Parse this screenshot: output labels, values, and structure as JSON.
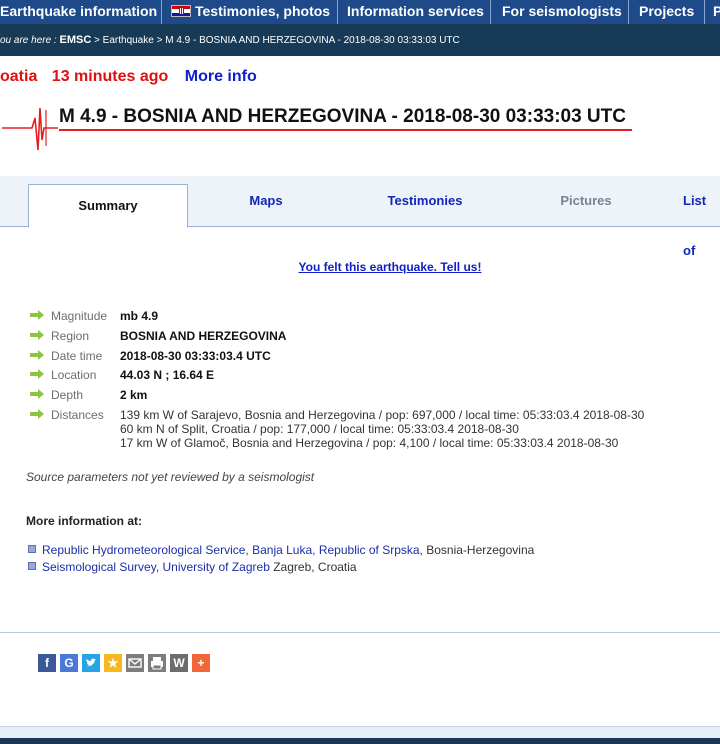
{
  "nav": {
    "items": [
      {
        "label": "Earthquake information"
      },
      {
        "label": "Testimonies, photos"
      },
      {
        "label": "Information services"
      },
      {
        "label": "For seismologists"
      },
      {
        "label": "Projects"
      },
      {
        "label": "P"
      }
    ]
  },
  "breadcrumb": {
    "prefix": "ou are here : ",
    "root": "EMSC",
    "rest": " > Earthquake > M 4.9 - BOSNIA AND HERZEGOVINA - 2018-08-30 03:33:03 UTC"
  },
  "headline": {
    "region_fragment": "oatia",
    "ago": "13 minutes ago",
    "more_info": "More info"
  },
  "title": "M 4.9 - BOSNIA AND HERZEGOVINA - 2018-08-30 03:33:03 UTC",
  "tabs": [
    {
      "label": "Summary",
      "state": "active"
    },
    {
      "label": "Maps",
      "state": "normal"
    },
    {
      "label": "Testimonies",
      "state": "normal"
    },
    {
      "label": "Pictures",
      "state": "disabled"
    },
    {
      "label": "List of",
      "state": "normal"
    }
  ],
  "felt_link": "You felt this earthquake. Tell us!",
  "details": {
    "magnitude": {
      "label": "Magnitude",
      "value": "mb 4.9"
    },
    "region": {
      "label": "Region",
      "value": "BOSNIA AND HERZEGOVINA"
    },
    "datetime": {
      "label": "Date time",
      "value": "2018-08-30 03:33:03.4 UTC"
    },
    "location": {
      "label": "Location",
      "value": "44.03 N ; 16.64 E"
    },
    "depth": {
      "label": "Depth",
      "value": "2 km"
    },
    "distances": {
      "label": "Distances",
      "lines": [
        "139 km W of Sarajevo, Bosnia and Herzegovina / pop: 697,000 / local time: 05:33:03.4 2018-08-30",
        "60 km N of Split, Croatia / pop: 177,000 / local time: 05:33:03.4 2018-08-30",
        "17 km W of Glamoč, Bosnia and Herzegovina / pop: 4,100 / local time: 05:33:03.4 2018-08-30"
      ]
    }
  },
  "source_note": "Source parameters not yet reviewed by a seismologist",
  "more_info_heading": "More information at:",
  "links": [
    {
      "a": "Republic Hydrometeorological Service, Banja Luka,",
      "b": "Republic of Srpska,",
      "c": "Bosnia-Herzegovina"
    },
    {
      "a": "Seismological Survey, University of Zagreb",
      "b": "",
      "c": "Zagreb, Croatia"
    }
  ],
  "share_icons": [
    "facebook-icon",
    "google-icon",
    "twitter-icon",
    "favorite-icon",
    "email-icon",
    "print-icon",
    "wordpress-icon",
    "more-icon"
  ],
  "colors": {
    "nav_bg": "#1e4a8a",
    "crumb_bg": "#173a57",
    "accent_red": "#e01010",
    "link_blue": "#1020c8"
  }
}
